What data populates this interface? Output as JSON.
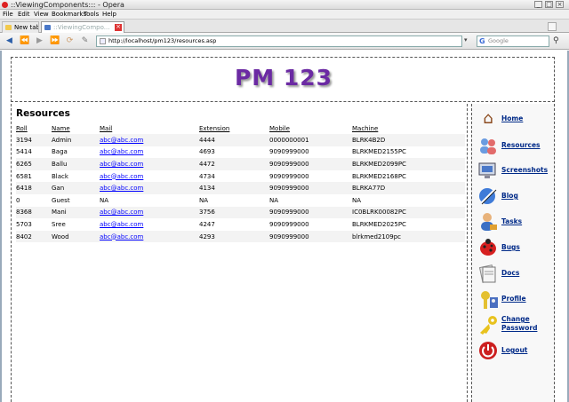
{
  "window": {
    "title": "::ViewingComponents::: - Opera",
    "controls": [
      "minimize-icon",
      "maximize-icon",
      "close-icon"
    ]
  },
  "menu": [
    "File",
    "Edit",
    "View",
    "Bookmarks",
    "Tools",
    "Help"
  ],
  "tabs": {
    "new_tab": "New tab",
    "active_tab": "::ViewingCompo..."
  },
  "toolbar": {
    "address": "http://localhost/pm123/resources.asp",
    "search_placeholder": "Google",
    "search_engine_glyph": "G"
  },
  "logo": "PM 123",
  "resources": {
    "title": "Resources",
    "columns": [
      "Roll",
      "Name",
      "Mail",
      "Extension",
      "Mobile",
      "Machine"
    ],
    "rows": [
      [
        "3194",
        "Admin",
        "abc@abc.com",
        "4444",
        "0000000001",
        "BLRK4B2D"
      ],
      [
        "5414",
        "Baga",
        "abc@abc.com",
        "4693",
        "9090999000",
        "BLRKMED2155PC"
      ],
      [
        "6265",
        "Ballu",
        "abc@abc.com",
        "4472",
        "9090999000",
        "BLRKMED2099PC"
      ],
      [
        "6581",
        "Black",
        "abc@abc.com",
        "4734",
        "9090999000",
        "BLRKMED2168PC"
      ],
      [
        "6418",
        "Gan",
        "abc@abc.com",
        "4134",
        "9090999000",
        "BLRKA77D"
      ],
      [
        "0",
        "Guest",
        "NA",
        "NA",
        "NA",
        "NA"
      ],
      [
        "8368",
        "Mani",
        "abc@abc.com",
        "3756",
        "9090999000",
        "IC0BLRK00082PC"
      ],
      [
        "5703",
        "Sree",
        "abc@abc.com",
        "4247",
        "9090999000",
        "BLRKMED2025PC"
      ],
      [
        "8402",
        "Wood",
        "abc@abc.com",
        "4293",
        "9090999000",
        "blrkmed2109pc"
      ]
    ]
  },
  "nav": {
    "home": "Home",
    "resources": "Resources",
    "screenshots": "Screenshots",
    "blog": "Blog",
    "tasks": "Tasks",
    "bugs": "Bugs",
    "docs": "Docs",
    "profile": "Profile",
    "change_password_1": "Change",
    "change_password_2": "Password",
    "logout": "Logout"
  },
  "colors": {
    "logo": "#6b2aa3",
    "nav_link": "#002a88",
    "mail_link": "#0000ff"
  }
}
